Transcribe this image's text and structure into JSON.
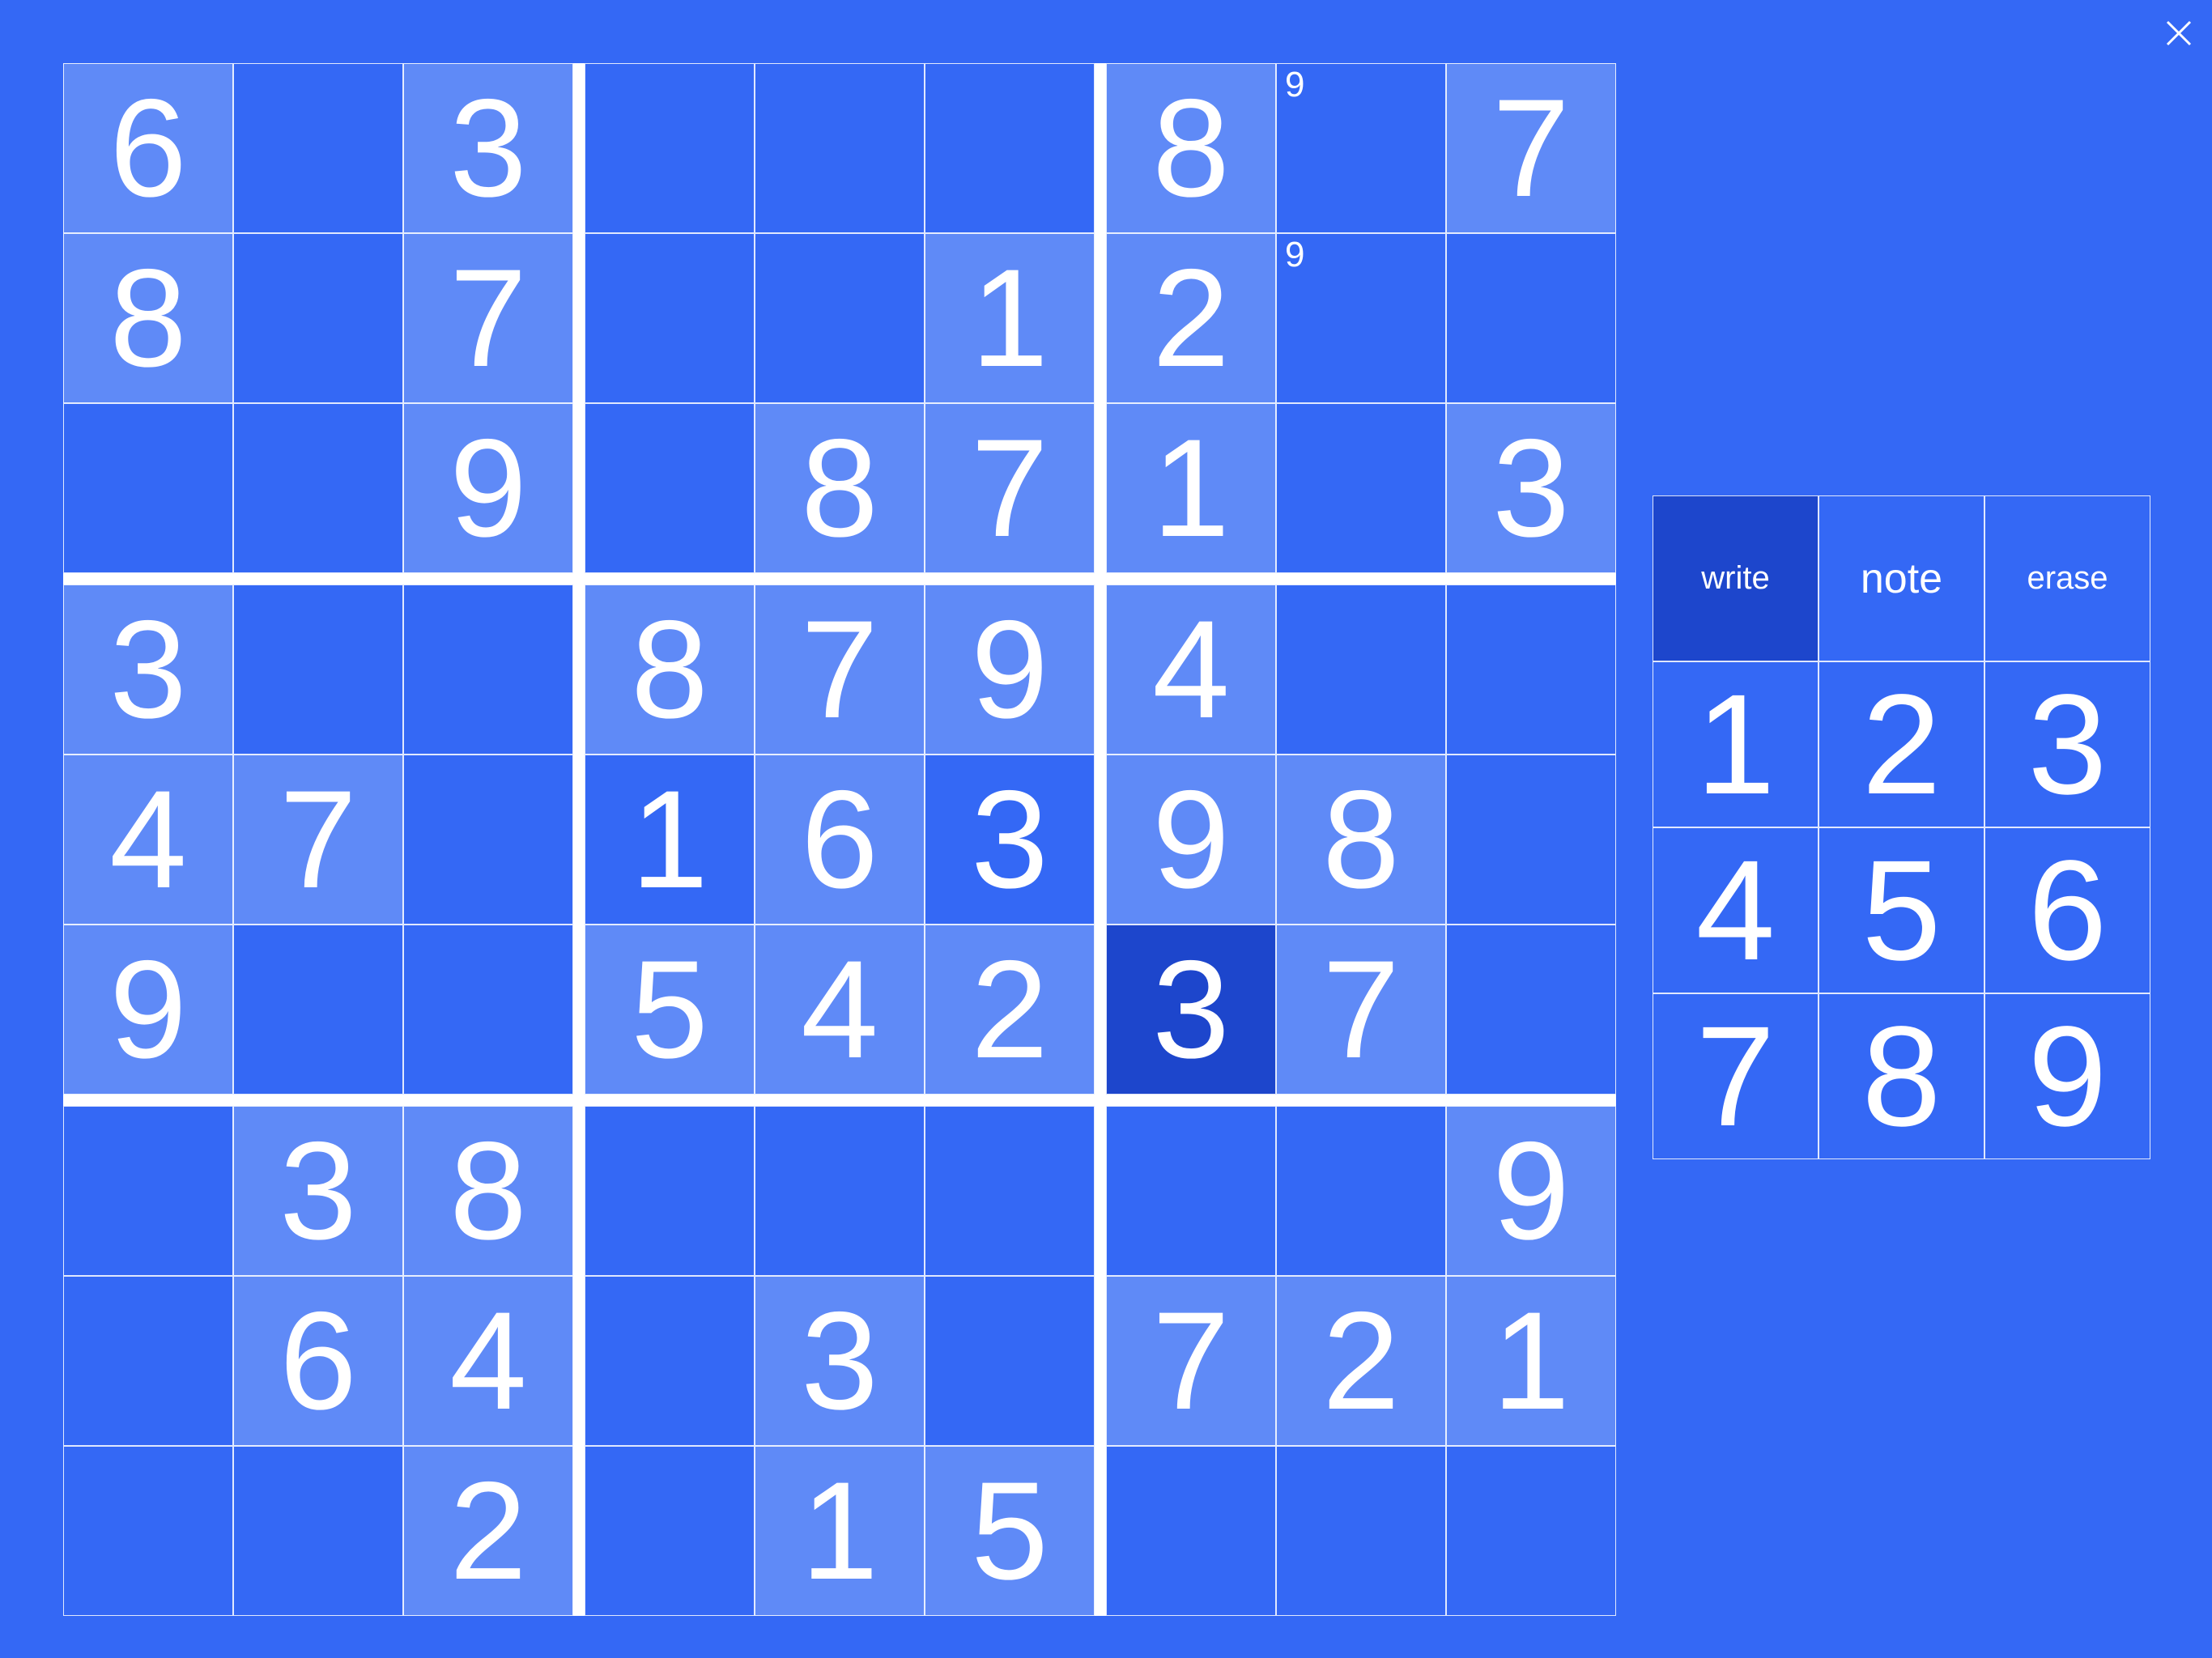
{
  "colors": {
    "background": "#3468F5",
    "given_cell": "#5F8AF7",
    "selected_cell": "#1D46CC",
    "text": "#FFFFFF"
  },
  "toolbar": {
    "close_icon": "close-icon"
  },
  "board": {
    "rows": [
      [
        {
          "v": "6",
          "s": "given"
        },
        {
          "v": "",
          "s": "plain"
        },
        {
          "v": "3",
          "s": "given"
        },
        {
          "v": "",
          "s": "plain"
        },
        {
          "v": "",
          "s": "plain"
        },
        {
          "v": "",
          "s": "plain"
        },
        {
          "v": "8",
          "s": "given"
        },
        {
          "v": "",
          "s": "plain",
          "note": "9"
        },
        {
          "v": "7",
          "s": "given"
        }
      ],
      [
        {
          "v": "8",
          "s": "given"
        },
        {
          "v": "",
          "s": "plain"
        },
        {
          "v": "7",
          "s": "given"
        },
        {
          "v": "",
          "s": "plain"
        },
        {
          "v": "",
          "s": "plain"
        },
        {
          "v": "1",
          "s": "given"
        },
        {
          "v": "2",
          "s": "given"
        },
        {
          "v": "",
          "s": "plain",
          "note": "9"
        },
        {
          "v": "",
          "s": "plain"
        }
      ],
      [
        {
          "v": "",
          "s": "plain"
        },
        {
          "v": "",
          "s": "plain"
        },
        {
          "v": "9",
          "s": "given"
        },
        {
          "v": "",
          "s": "plain"
        },
        {
          "v": "8",
          "s": "given"
        },
        {
          "v": "7",
          "s": "given"
        },
        {
          "v": "1",
          "s": "given"
        },
        {
          "v": "",
          "s": "plain"
        },
        {
          "v": "3",
          "s": "given"
        }
      ],
      [
        {
          "v": "3",
          "s": "given"
        },
        {
          "v": "",
          "s": "plain"
        },
        {
          "v": "",
          "s": "plain"
        },
        {
          "v": "8",
          "s": "given"
        },
        {
          "v": "7",
          "s": "given"
        },
        {
          "v": "9",
          "s": "given"
        },
        {
          "v": "4",
          "s": "given"
        },
        {
          "v": "",
          "s": "plain"
        },
        {
          "v": "",
          "s": "plain"
        }
      ],
      [
        {
          "v": "4",
          "s": "given"
        },
        {
          "v": "7",
          "s": "given"
        },
        {
          "v": "",
          "s": "plain"
        },
        {
          "v": "1",
          "s": "filled"
        },
        {
          "v": "6",
          "s": "given"
        },
        {
          "v": "3",
          "s": "filled"
        },
        {
          "v": "9",
          "s": "given"
        },
        {
          "v": "8",
          "s": "given"
        },
        {
          "v": "",
          "s": "plain"
        }
      ],
      [
        {
          "v": "9",
          "s": "given"
        },
        {
          "v": "",
          "s": "plain"
        },
        {
          "v": "",
          "s": "plain"
        },
        {
          "v": "5",
          "s": "given"
        },
        {
          "v": "4",
          "s": "given"
        },
        {
          "v": "2",
          "s": "given"
        },
        {
          "v": "3",
          "s": "selected"
        },
        {
          "v": "7",
          "s": "given"
        },
        {
          "v": "",
          "s": "plain"
        }
      ],
      [
        {
          "v": "",
          "s": "plain"
        },
        {
          "v": "3",
          "s": "given"
        },
        {
          "v": "8",
          "s": "given"
        },
        {
          "v": "",
          "s": "plain"
        },
        {
          "v": "",
          "s": "plain"
        },
        {
          "v": "",
          "s": "plain"
        },
        {
          "v": "",
          "s": "plain"
        },
        {
          "v": "",
          "s": "plain"
        },
        {
          "v": "9",
          "s": "given"
        }
      ],
      [
        {
          "v": "",
          "s": "plain"
        },
        {
          "v": "6",
          "s": "given"
        },
        {
          "v": "4",
          "s": "given"
        },
        {
          "v": "",
          "s": "plain"
        },
        {
          "v": "3",
          "s": "given"
        },
        {
          "v": "",
          "s": "plain"
        },
        {
          "v": "7",
          "s": "given"
        },
        {
          "v": "2",
          "s": "given"
        },
        {
          "v": "1",
          "s": "given"
        }
      ],
      [
        {
          "v": "",
          "s": "plain"
        },
        {
          "v": "",
          "s": "plain"
        },
        {
          "v": "2",
          "s": "given"
        },
        {
          "v": "",
          "s": "plain"
        },
        {
          "v": "1",
          "s": "given"
        },
        {
          "v": "5",
          "s": "given"
        },
        {
          "v": "",
          "s": "plain"
        },
        {
          "v": "",
          "s": "plain"
        },
        {
          "v": "",
          "s": "plain"
        }
      ]
    ]
  },
  "pad": {
    "modes": [
      {
        "label": "write",
        "active": true
      },
      {
        "label": "note",
        "active": false
      },
      {
        "label": "erase",
        "active": false
      }
    ],
    "digits": [
      "1",
      "2",
      "3",
      "4",
      "5",
      "6",
      "7",
      "8",
      "9"
    ]
  }
}
